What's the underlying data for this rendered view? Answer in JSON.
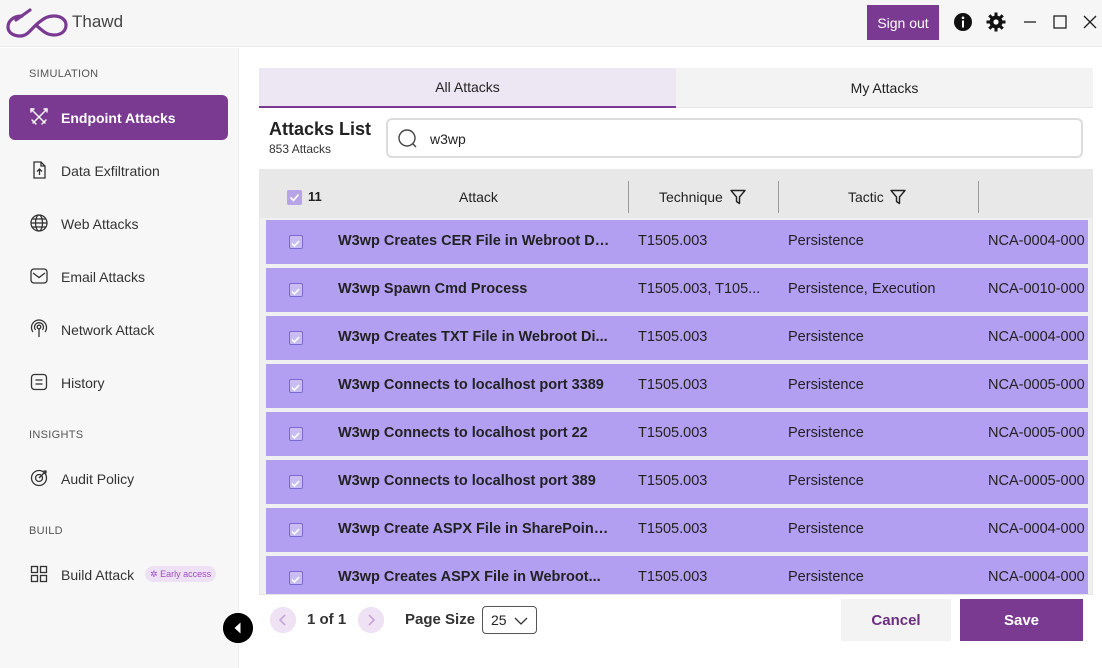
{
  "app": {
    "name": "Thawd",
    "logo_icon": "infinity-logo-icon"
  },
  "titlebar": {
    "signout_label": "Sign out",
    "icons": [
      "info-icon",
      "gear-icon",
      "minimize-icon",
      "maximize-icon",
      "close-icon"
    ]
  },
  "sidebar": {
    "sections": {
      "simulation": "SIMULATION",
      "insights": "INSIGHTS",
      "build": "BUILD"
    },
    "items": [
      {
        "label": "Endpoint Attacks",
        "icon": "swords-icon",
        "active": true
      },
      {
        "label": "Data Exfiltration",
        "icon": "file-upload-icon"
      },
      {
        "label": "Web Attacks",
        "icon": "globe-icon"
      },
      {
        "label": "Email Attacks",
        "icon": "envelope-icon"
      },
      {
        "label": "Network Attack",
        "icon": "broadcast-icon"
      },
      {
        "label": "History",
        "icon": "list-icon"
      },
      {
        "label": "Audit Policy",
        "icon": "target-icon"
      },
      {
        "label": "Build Attack",
        "icon": "grid-icon",
        "badge": "Early access"
      }
    ]
  },
  "tabs": [
    {
      "label": "All Attacks",
      "active": true
    },
    {
      "label": "My Attacks",
      "active": false
    }
  ],
  "list": {
    "title": "Attacks List",
    "count": "853 Attacks"
  },
  "search": {
    "value": "w3wp"
  },
  "table": {
    "selected_count": "11",
    "columns": [
      "Attack",
      "Technique",
      "Tactic"
    ],
    "rows": [
      {
        "attack": "W3wp Creates CER File in Webroot Di...",
        "technique": "T1505.003",
        "tactic": "Persistence",
        "id": "NCA-0004-000"
      },
      {
        "attack": "W3wp Spawn Cmd Process",
        "technique": "T1505.003, T105...",
        "tactic": "Persistence, Execution",
        "id": "NCA-0010-000"
      },
      {
        "attack": "W3wp Creates TXT File in Webroot Di...",
        "technique": "T1505.003",
        "tactic": "Persistence",
        "id": "NCA-0004-000"
      },
      {
        "attack": "W3wp Connects to localhost port 3389",
        "technique": "T1505.003",
        "tactic": "Persistence",
        "id": "NCA-0005-000"
      },
      {
        "attack": "W3wp Connects to localhost port 22",
        "technique": "T1505.003",
        "tactic": "Persistence",
        "id": "NCA-0005-000"
      },
      {
        "attack": "W3wp Connects to localhost port 389",
        "technique": "T1505.003",
        "tactic": "Persistence",
        "id": "NCA-0005-000"
      },
      {
        "attack": "W3wp Create ASPX File in SharePoint...",
        "technique": "T1505.003",
        "tactic": "Persistence",
        "id": "NCA-0004-000"
      },
      {
        "attack": "W3wp Creates ASPX File in Webroot...",
        "technique": "T1505.003",
        "tactic": "Persistence",
        "id": "NCA-0004-000"
      }
    ]
  },
  "pagination": {
    "page_text": "1 of 1",
    "page_size_label": "Page Size",
    "page_size_value": "25"
  },
  "actions": {
    "cancel_label": "Cancel",
    "save_label": "Save"
  },
  "colors": {
    "accent": "#7b3a92",
    "row_selected": "#b29ff2",
    "badge_text": "#9c4fc0"
  }
}
